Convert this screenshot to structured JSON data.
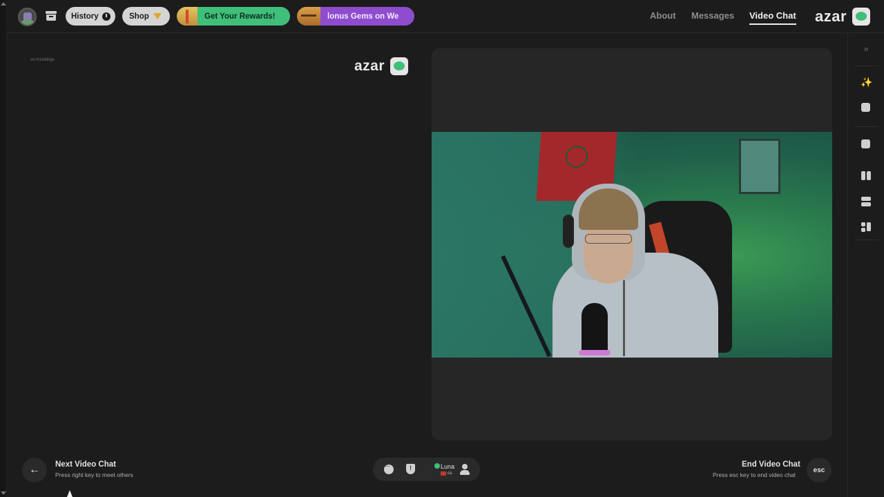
{
  "topbar": {
    "history_label": "History",
    "shop_label": "Shop",
    "rewards_label": "Get Your Rewards!",
    "gems_label": "lonus Gems on We",
    "nav": {
      "about": "About",
      "messages": "Messages",
      "video_chat": "Video Chat"
    },
    "brand": "azar"
  },
  "chat_panel": {
    "brand": "azar",
    "sub_text": "xe+h1e66Ige"
  },
  "bottom_bar": {
    "next_title": "Next Video Chat",
    "next_sub": "Press right key to meet others",
    "partner_name": "Luna",
    "partner_country": "cs",
    "end_title": "End Video Chat",
    "end_sub": "Press esc key to end video chat",
    "esc_label": "esc"
  },
  "icons": {
    "next_arrow": "←",
    "collapse": "»",
    "wand": "✨"
  },
  "colors": {
    "rewards_green": "#3fbf7a",
    "gems_purple": "#8e4ccf",
    "background": "#1c1c1c"
  }
}
